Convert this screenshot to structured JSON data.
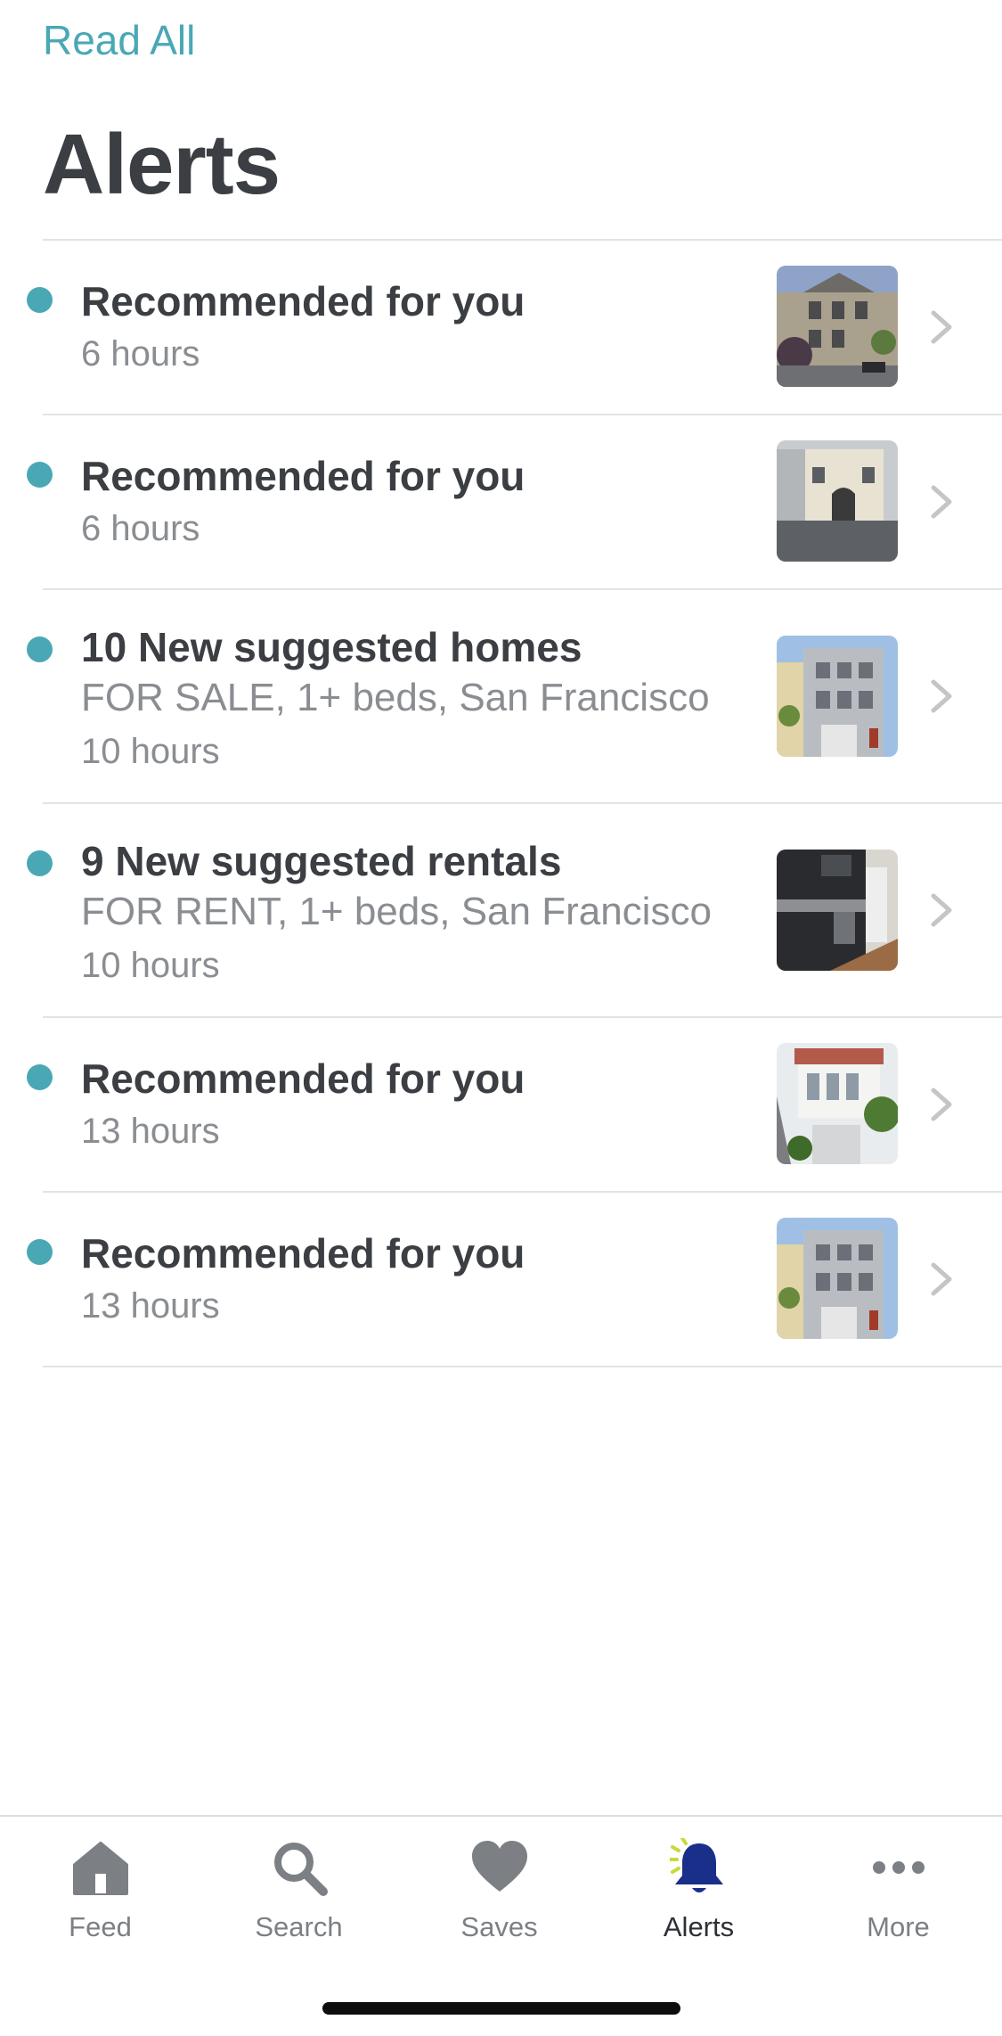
{
  "header": {
    "read_all": "Read All",
    "title": "Alerts"
  },
  "colors": {
    "accent": "#4aa8b5",
    "unread_dot": "#4aa8b5",
    "active_tab": "#1a2f8a"
  },
  "alerts": [
    {
      "title": "Recommended for you",
      "subtitle": "",
      "time": "6 hours",
      "unread": true,
      "thumbnail": "victorian-house-photo"
    },
    {
      "title": "Recommended for you",
      "subtitle": "",
      "time": "6 hours",
      "unread": true,
      "thumbnail": "stucco-building-photo"
    },
    {
      "title": "10 New suggested homes",
      "subtitle": "FOR SALE, 1+ beds, San Francisco",
      "time": "10 hours",
      "unread": true,
      "thumbnail": "grey-townhouse-photo"
    },
    {
      "title": "9 New suggested rentals",
      "subtitle": "FOR RENT, 1+ beds, San Francisco",
      "time": "10 hours",
      "unread": true,
      "thumbnail": "kitchen-interior-photo"
    },
    {
      "title": "Recommended for you",
      "subtitle": "",
      "time": "13 hours",
      "unread": true,
      "thumbnail": "white-house-photo"
    },
    {
      "title": "Recommended for you",
      "subtitle": "",
      "time": "13 hours",
      "unread": true,
      "thumbnail": "grey-townhouse-photo"
    }
  ],
  "tabbar": {
    "tabs": [
      {
        "label": "Feed",
        "icon": "home-icon",
        "active": false
      },
      {
        "label": "Search",
        "icon": "search-icon",
        "active": false
      },
      {
        "label": "Saves",
        "icon": "heart-icon",
        "active": false
      },
      {
        "label": "Alerts",
        "icon": "bell-icon",
        "active": true
      },
      {
        "label": "More",
        "icon": "more-icon",
        "active": false
      }
    ]
  }
}
